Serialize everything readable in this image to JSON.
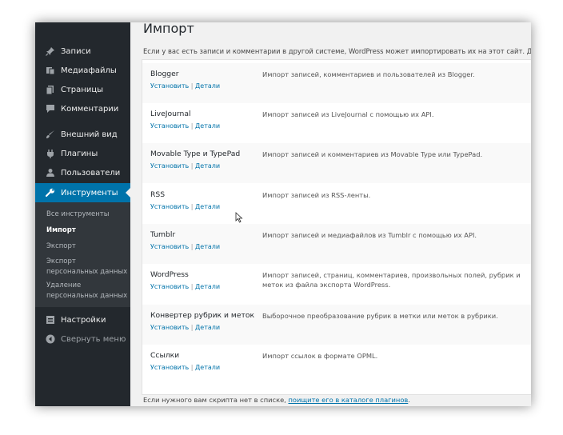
{
  "sidebar": {
    "menu": [
      {
        "label": "Записи",
        "icon": "pushpin-icon"
      },
      {
        "label": "Медиафайлы",
        "icon": "media-icon"
      },
      {
        "label": "Страницы",
        "icon": "pages-icon"
      },
      {
        "label": "Комментарии",
        "icon": "comments-icon"
      },
      {
        "label": "Внешний вид",
        "icon": "appearance-brush-icon"
      },
      {
        "label": "Плагины",
        "icon": "plugins-icon"
      },
      {
        "label": "Пользователи",
        "icon": "users-icon"
      },
      {
        "label": "Инструменты",
        "icon": "wrench-icon"
      },
      {
        "label": "Настройки",
        "icon": "settings-icon"
      }
    ],
    "submenu": [
      {
        "label": "Все инструменты"
      },
      {
        "label": "Импорт"
      },
      {
        "label": "Экспорт"
      },
      {
        "label": "Экспорт персональных данных"
      },
      {
        "label": "Удаление персональных данных"
      }
    ],
    "collapse_label": "Свернуть меню",
    "active_color": "#0073aa",
    "background_color": "#23282d"
  },
  "main": {
    "title": "Импорт",
    "intro": "Если у вас есть записи и комментарии в другой системе, WordPress может импортировать их на этот сайт. Для нача",
    "importers": [
      {
        "name": "Blogger",
        "install": "Установить",
        "separator": "|",
        "details": "Детали",
        "description": "Импорт записей, комментариев и пользователей из Blogger."
      },
      {
        "name": "LiveJournal",
        "install": "Установить",
        "separator": "|",
        "details": "Детали",
        "description": "Импорт записей из LiveJournal с помощью их API."
      },
      {
        "name": "Movable Type и TypePad",
        "install": "Установить",
        "separator": "|",
        "details": "Детали",
        "description": "Импорт записей и комментариев из Movable Type или TypePad."
      },
      {
        "name": "RSS",
        "install": "Установить",
        "separator": "|",
        "details": "Детали",
        "description": "Импорт записей из RSS-ленты."
      },
      {
        "name": "Tumblr",
        "install": "Установить",
        "separator": "|",
        "details": "Детали",
        "description": "Импорт записей и медиафайлов из Tumblr с помощью их API."
      },
      {
        "name": "WordPress",
        "install": "Установить",
        "separator": "|",
        "details": "Детали",
        "description": "Импорт записей, страниц, комментариев, произвольных полей, рубрик и меток из файла экспорта WordPress."
      },
      {
        "name": "Конвертер рубрик и меток",
        "install": "Установить",
        "separator": "|",
        "details": "Детали",
        "description": "Выборочное преобразование рубрик в метки или меток в рубрики."
      },
      {
        "name": "Ссылки",
        "install": "Установить",
        "separator": "|",
        "details": "Детали",
        "description": "Импорт ссылок в формате OPML."
      }
    ],
    "footer_prefix": "Если нужного вам скрипта нет в списке, ",
    "footer_link": "поищите его в каталоге плагинов",
    "footer_suffix": ".",
    "link_color": "#0073aa"
  }
}
